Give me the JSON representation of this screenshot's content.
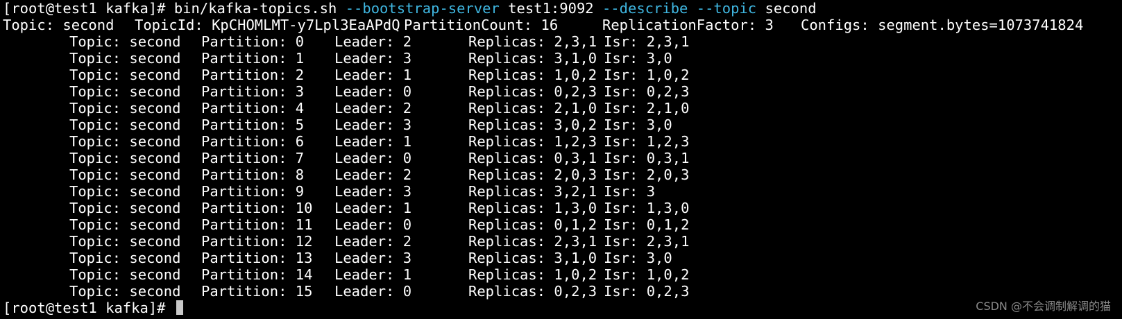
{
  "terminal": {
    "prompt": "[root@test1 kafka]# ",
    "command": {
      "program": "bin/kafka-topics.sh",
      "opt_bootstrap": "--bootstrap-server",
      "bootstrap_value": "test1:9092",
      "opt_describe": "--describe",
      "opt_topic": "--topic",
      "topic_value": "second"
    },
    "summary": {
      "topic": "Topic: second",
      "topic_id": "TopicId: KpCHOMLMT-y7Lpl3EaAPdQ",
      "partition_count": "PartitionCount: 16",
      "replication_factor": "ReplicationFactor: 3",
      "configs": "Configs: segment.bytes=1073741824"
    },
    "partitions": [
      {
        "topic": "Topic: second",
        "partition": "Partition: 0",
        "leader": "Leader: 2",
        "replicas": "Replicas: 2,3,1",
        "isr": "Isr: 2,3,1"
      },
      {
        "topic": "Topic: second",
        "partition": "Partition: 1",
        "leader": "Leader: 3",
        "replicas": "Replicas: 3,1,0",
        "isr": "Isr: 3,0"
      },
      {
        "topic": "Topic: second",
        "partition": "Partition: 2",
        "leader": "Leader: 1",
        "replicas": "Replicas: 1,0,2",
        "isr": "Isr: 1,0,2"
      },
      {
        "topic": "Topic: second",
        "partition": "Partition: 3",
        "leader": "Leader: 0",
        "replicas": "Replicas: 0,2,3",
        "isr": "Isr: 0,2,3"
      },
      {
        "topic": "Topic: second",
        "partition": "Partition: 4",
        "leader": "Leader: 2",
        "replicas": "Replicas: 2,1,0",
        "isr": "Isr: 2,1,0"
      },
      {
        "topic": "Topic: second",
        "partition": "Partition: 5",
        "leader": "Leader: 3",
        "replicas": "Replicas: 3,0,2",
        "isr": "Isr: 3,0"
      },
      {
        "topic": "Topic: second",
        "partition": "Partition: 6",
        "leader": "Leader: 1",
        "replicas": "Replicas: 1,2,3",
        "isr": "Isr: 1,2,3"
      },
      {
        "topic": "Topic: second",
        "partition": "Partition: 7",
        "leader": "Leader: 0",
        "replicas": "Replicas: 0,3,1",
        "isr": "Isr: 0,3,1"
      },
      {
        "topic": "Topic: second",
        "partition": "Partition: 8",
        "leader": "Leader: 2",
        "replicas": "Replicas: 2,0,3",
        "isr": "Isr: 2,0,3"
      },
      {
        "topic": "Topic: second",
        "partition": "Partition: 9",
        "leader": "Leader: 3",
        "replicas": "Replicas: 3,2,1",
        "isr": "Isr: 3"
      },
      {
        "topic": "Topic: second",
        "partition": "Partition: 10",
        "leader": "Leader: 1",
        "replicas": "Replicas: 1,3,0",
        "isr": "Isr: 1,3,0"
      },
      {
        "topic": "Topic: second",
        "partition": "Partition: 11",
        "leader": "Leader: 0",
        "replicas": "Replicas: 0,1,2",
        "isr": "Isr: 0,1,2"
      },
      {
        "topic": "Topic: second",
        "partition": "Partition: 12",
        "leader": "Leader: 2",
        "replicas": "Replicas: 2,3,1",
        "isr": "Isr: 2,3,1"
      },
      {
        "topic": "Topic: second",
        "partition": "Partition: 13",
        "leader": "Leader: 3",
        "replicas": "Replicas: 3,1,0",
        "isr": "Isr: 3,0"
      },
      {
        "topic": "Topic: second",
        "partition": "Partition: 14",
        "leader": "Leader: 1",
        "replicas": "Replicas: 1,0,2",
        "isr": "Isr: 1,0,2"
      },
      {
        "topic": "Topic: second",
        "partition": "Partition: 15",
        "leader": "Leader: 0",
        "replicas": "Replicas: 0,2,3",
        "isr": "Isr: 0,2,3"
      }
    ],
    "final_prompt": "[root@test1 kafka]# "
  },
  "watermark": "CSDN @不会调制解调的猫",
  "colors": {
    "background": "#000000",
    "text": "#ffffff",
    "option": "#3fb6e0",
    "cursor": "#c8c8c8",
    "watermark": "#8a8a8a"
  }
}
